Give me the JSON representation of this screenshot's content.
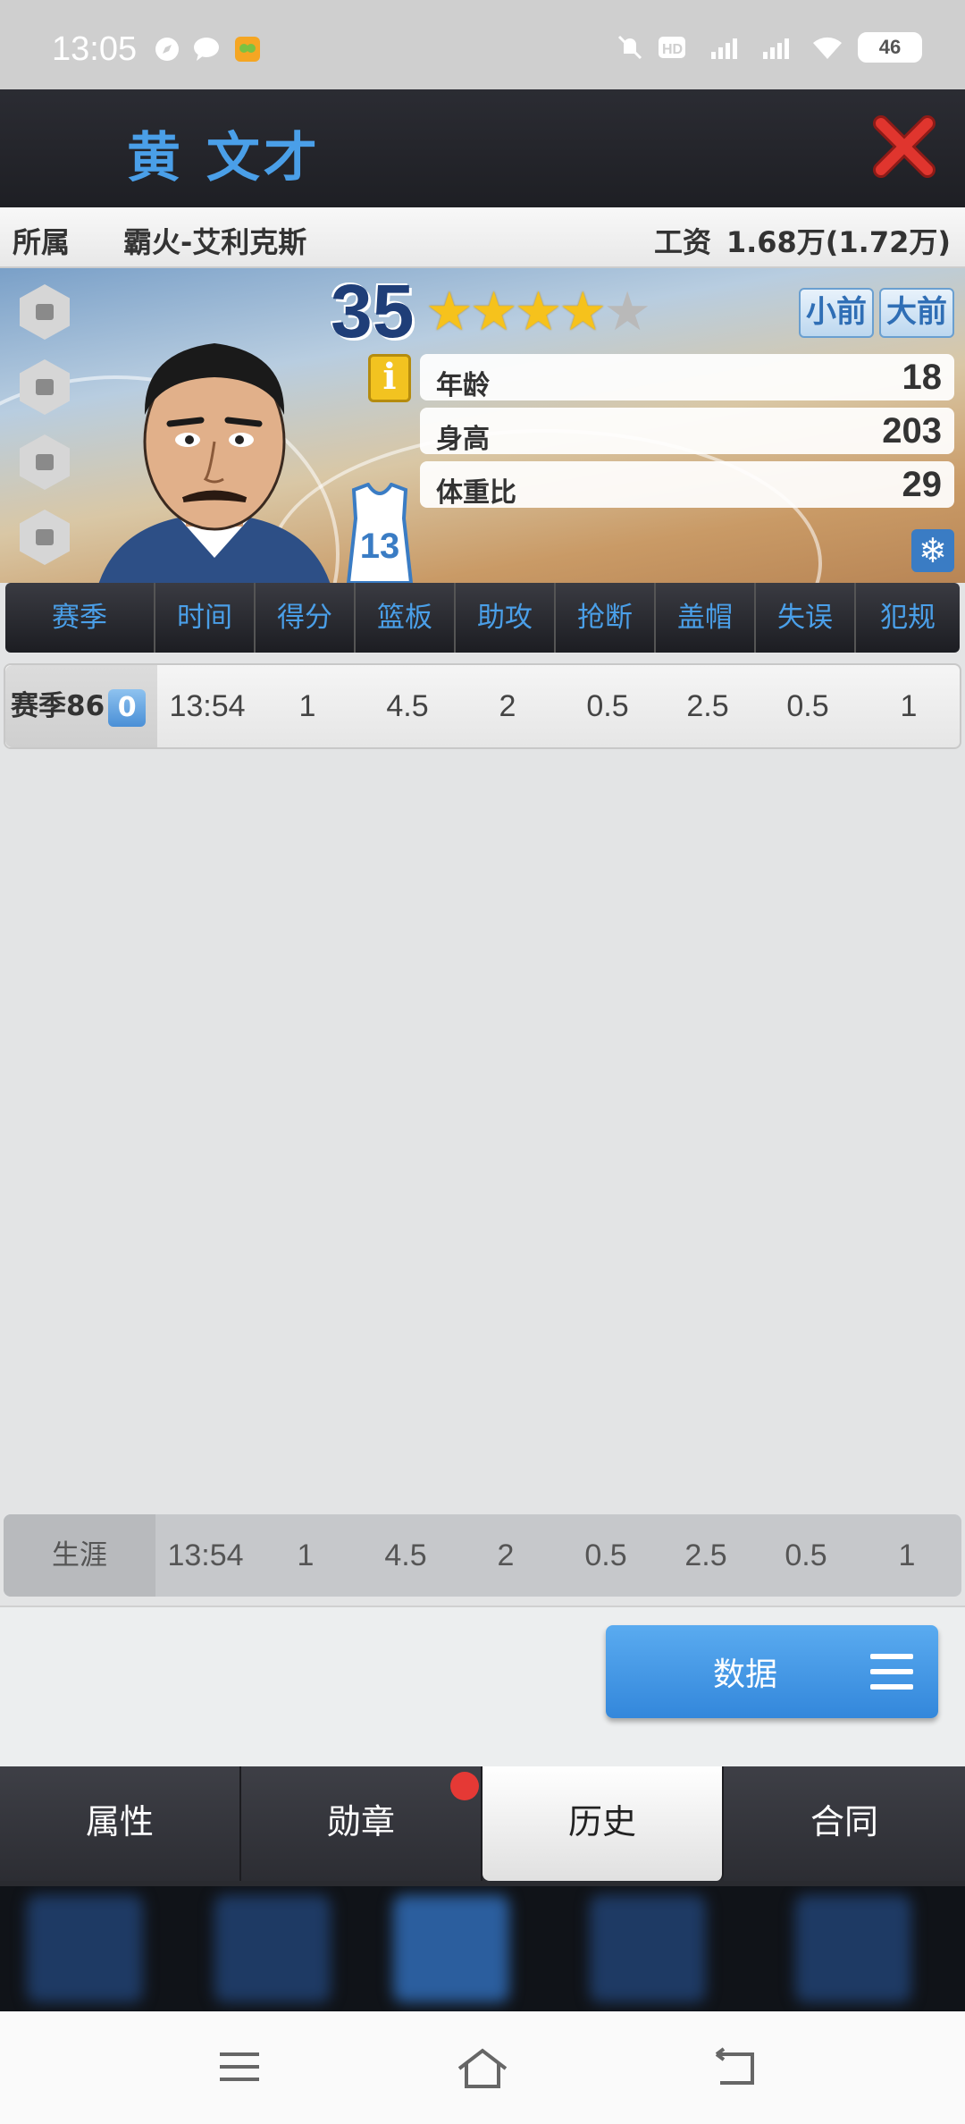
{
  "status": {
    "time": "13:05",
    "battery": "46"
  },
  "player": {
    "name": "黄 文才",
    "rating": "35",
    "stars_filled": 4,
    "stars_total": 5
  },
  "team": {
    "label": "所属",
    "name": "霸火-艾利克斯",
    "salary_label": "工资",
    "salary": "1.68万(1.72万)"
  },
  "positions": [
    "小前",
    "大前"
  ],
  "attributes": [
    {
      "label": "年龄",
      "value": "18"
    },
    {
      "label": "身高",
      "value": "203"
    },
    {
      "label": "体重比",
      "value": "29"
    }
  ],
  "jersey_number": "13",
  "table": {
    "headers": [
      "赛季",
      "时间",
      "得分",
      "篮板",
      "助攻",
      "抢断",
      "盖帽",
      "失误",
      "犯规"
    ],
    "rows": [
      {
        "season": "赛季86",
        "badge": "0",
        "values": [
          "13:54",
          "1",
          "4.5",
          "2",
          "0.5",
          "2.5",
          "0.5",
          "1"
        ]
      }
    ],
    "career": {
      "label": "生涯",
      "values": [
        "13:54",
        "1",
        "4.5",
        "2",
        "0.5",
        "2.5",
        "0.5",
        "1"
      ]
    }
  },
  "data_button": "数据",
  "tabs": [
    {
      "label": "属性",
      "active": false
    },
    {
      "label": "勋章",
      "active": false,
      "notification": true
    },
    {
      "label": "历史",
      "active": true
    },
    {
      "label": "合同",
      "active": false
    }
  ],
  "colors": {
    "accent": "#4a9fe8",
    "close": "#d9322b",
    "star": "#f6c21c"
  }
}
